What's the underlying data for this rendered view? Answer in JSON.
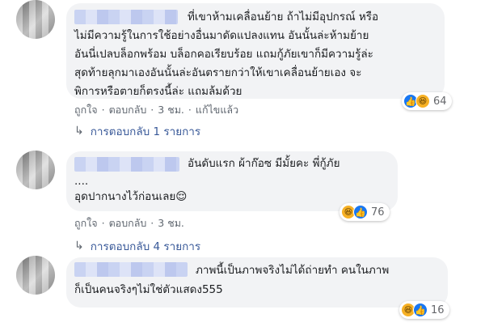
{
  "comments": [
    {
      "lines": [
        "ที่เขาห้ามเคลื่อนย้าย ถ้าไม่มีอุปกรณ์ หรือ",
        "ไม่มีความรู้ในการใช้อย่างอื่นมาดัดแปลงแทน อันนั้นล่ะห้ามย้าย",
        "อันนี่เปลบล็อกพร้อม บล็อกคอเรียบร้อย แถมกู้ภัยเขาก็มีความรู้ล่ะ",
        "สุดท้ายลุกมาเองอันนั้นล่ะอันตรายกว่าให้เขาเคลื่อนย้ายเอง จะ",
        "พิการหรือตายก็ตรงนี้ล่ะ แถมล้มด้วย"
      ],
      "actions": {
        "like": "ถูกใจ",
        "reply": "ตอบกลับ",
        "time": "3 ชม.",
        "edited": "แก้ไขแล้ว"
      },
      "reaction_count": "64",
      "reactions": [
        "like-icon",
        "haha-icon"
      ],
      "replies_label": "การตอบกลับ 1 รายการ"
    },
    {
      "lines": [
        "อันดับแรก ผ้าก๊อซ มีมั้ยคะ พี่กู้ภัย",
        "....",
        "อุดปากนางไว้ก่อนเลย😌"
      ],
      "actions": {
        "like": "ถูกใจ",
        "reply": "ตอบกลับ",
        "time": "3 ชม."
      },
      "reaction_count": "76",
      "reactions": [
        "haha-icon",
        "like-icon"
      ],
      "replies_label": "การตอบกลับ 4 รายการ"
    },
    {
      "lines": [
        "ภาพนี้เป็นภาพจริงไม่ได้ถ่ายทำ คนในภาพ",
        "ก็เป็นคนจริงๆไม่ใช่ตัวแสดง555"
      ],
      "reaction_count": "16",
      "reactions": [
        "haha-icon",
        "like-icon"
      ]
    }
  ],
  "separator": "·",
  "reply_arrow": "↳",
  "colors": {
    "bubble": "#f2f3f5",
    "link": "#385898",
    "meta": "#606770",
    "like": "#1877f2",
    "haha": "#f7b125"
  }
}
